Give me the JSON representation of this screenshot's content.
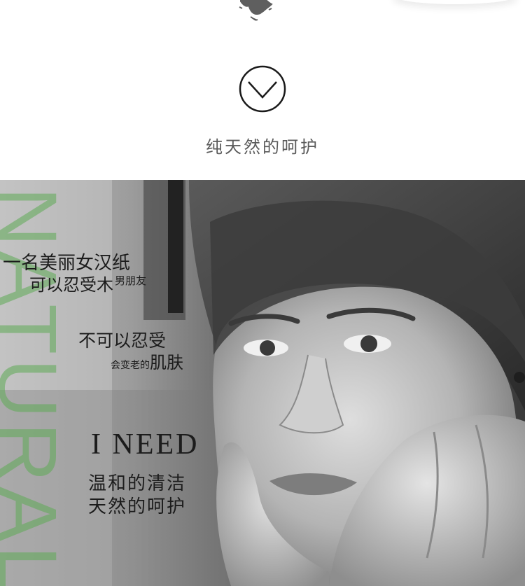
{
  "header": {
    "title": "纯天然的呵护"
  },
  "photo": {
    "vertical_word": "NATURAL",
    "lines": {
      "line1": "一名美丽女汉纸",
      "line2_main": "可以忍受木",
      "line2_small": "男朋友",
      "line3": "不可以忍受",
      "line4_small": "会变老的",
      "line4_main": "肌肤",
      "line5": "I NEED",
      "line6": "温和的清洁",
      "line7": "天然的呵护"
    }
  },
  "colors": {
    "accent_green": "#5caa54",
    "heading_text": "#5a5a5a"
  },
  "icons": {
    "header_icon": "chevron-down-circle-icon"
  }
}
